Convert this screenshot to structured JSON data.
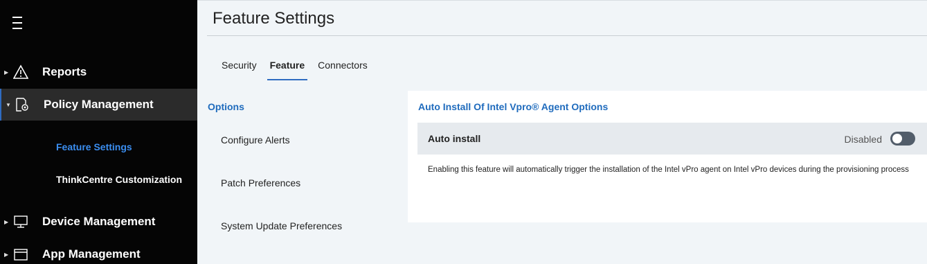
{
  "sidebar": {
    "items": [
      {
        "label": "Reports",
        "icon": "warning-triangle-icon"
      },
      {
        "label": "Policy Management",
        "icon": "policy-gear-icon"
      },
      {
        "label": "Device Management",
        "icon": "monitor-icon"
      },
      {
        "label": "App Management",
        "icon": "app-window-icon"
      }
    ],
    "subitems": [
      {
        "label": "Feature Settings"
      },
      {
        "label": "ThinkCentre Customization"
      }
    ]
  },
  "page": {
    "title": "Feature Settings"
  },
  "tabs": [
    {
      "label": "Security"
    },
    {
      "label": "Feature"
    },
    {
      "label": "Connectors"
    }
  ],
  "options": {
    "title": "Options",
    "items": [
      {
        "label": "Configure Alerts"
      },
      {
        "label": "Patch Preferences"
      },
      {
        "label": "System Update Preferences"
      }
    ]
  },
  "panel": {
    "title": "Auto Install Of Intel Vpro® Agent Options",
    "setting_label": "Auto install",
    "setting_status": "Disabled",
    "description": "Enabling this feature will automatically trigger the installation of the Intel vPro agent on Intel vPro devices during the provisioning process"
  },
  "colors": {
    "accent": "#2f6cc1",
    "link": "#1f6bbd",
    "active_sub": "#3b8ef0"
  }
}
